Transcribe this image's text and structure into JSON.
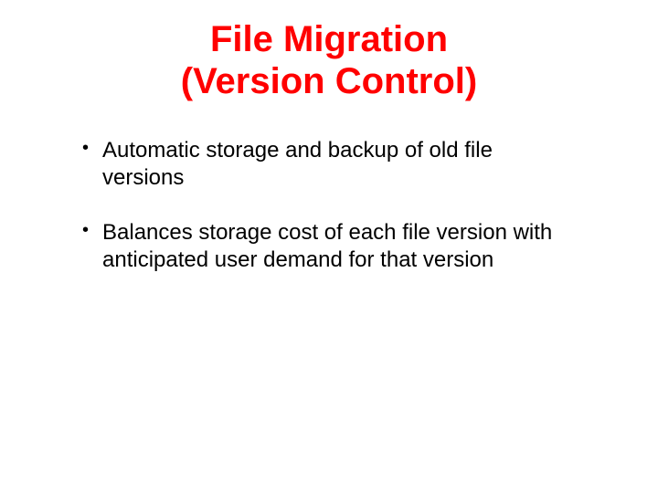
{
  "slide": {
    "title_line1": "File Migration",
    "title_line2": "(Version Control)",
    "bullets": [
      "Automatic storage and backup of old file versions",
      "Balances storage cost of each file version with anticipated user demand for that version"
    ]
  }
}
